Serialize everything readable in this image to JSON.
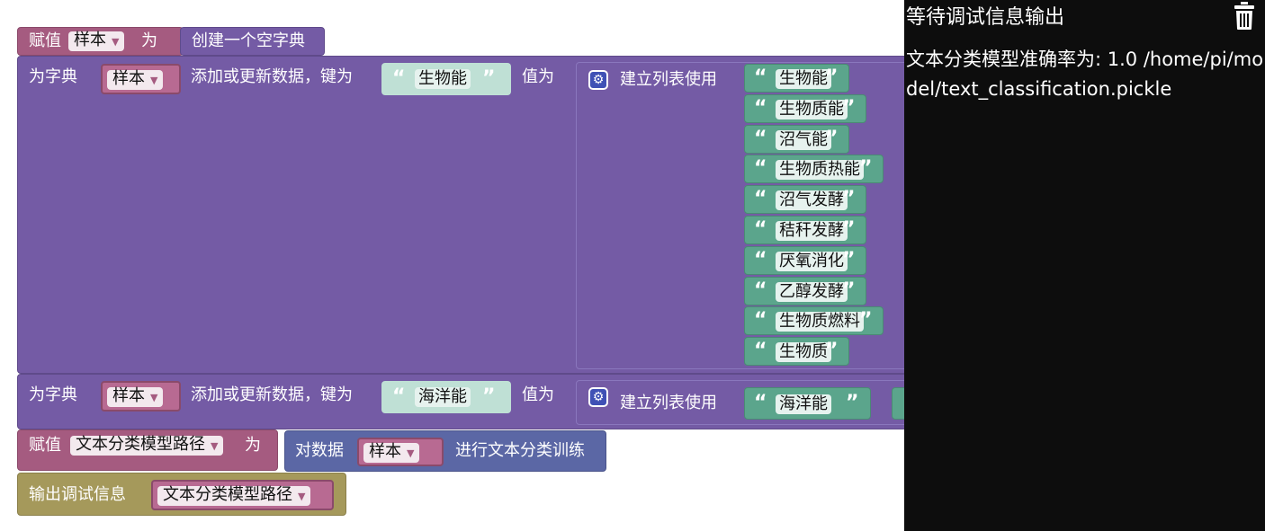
{
  "blocks": {
    "assign1": {
      "label": "赋值",
      "var": "样本",
      "to": "为",
      "value": "创建一个空字典"
    },
    "dict_add1": {
      "prefix": "为字典",
      "dict": "样本",
      "action": "添加或更新数据，键为",
      "key": "生物能",
      "value_label": "值为",
      "list_label": "建立列表使用",
      "items": [
        "生物能",
        "生物质能",
        "沼气能",
        "生物质热能",
        "沼气发酵",
        "秸秆发酵",
        "厌氧消化",
        "乙醇发酵",
        "生物质燃料",
        "生物质"
      ]
    },
    "dict_add2": {
      "prefix": "为字典",
      "dict": "样本",
      "action": "添加或更新数据，键为",
      "key": "海洋能",
      "value_label": "值为",
      "list_label": "建立列表使用",
      "items": [
        "海洋能"
      ]
    },
    "assign2": {
      "label": "赋值",
      "var": "文本分类模型路径",
      "to": "为",
      "train_prefix": "对数据",
      "train_data": "样本",
      "train_suffix": "进行文本分类训练"
    },
    "debug": {
      "label": "输出调试信息",
      "var": "文本分类模型路径"
    }
  },
  "console": {
    "title": "等待调试信息输出",
    "output": "文本分类模型准确率为: 1.0 /home/pi/model/text_classification.pickle"
  },
  "colors": {
    "variables": "#a55b80",
    "dict": "#745ba5",
    "text": "#5ba58c",
    "debug": "#a5995b",
    "ai": "#5b67a5",
    "console_bg": "#0d0d0d"
  },
  "icons": [
    "gear-icon",
    "trash-icon",
    "dropdown-arrow-icon",
    "quote-open-icon",
    "quote-close-icon"
  ]
}
